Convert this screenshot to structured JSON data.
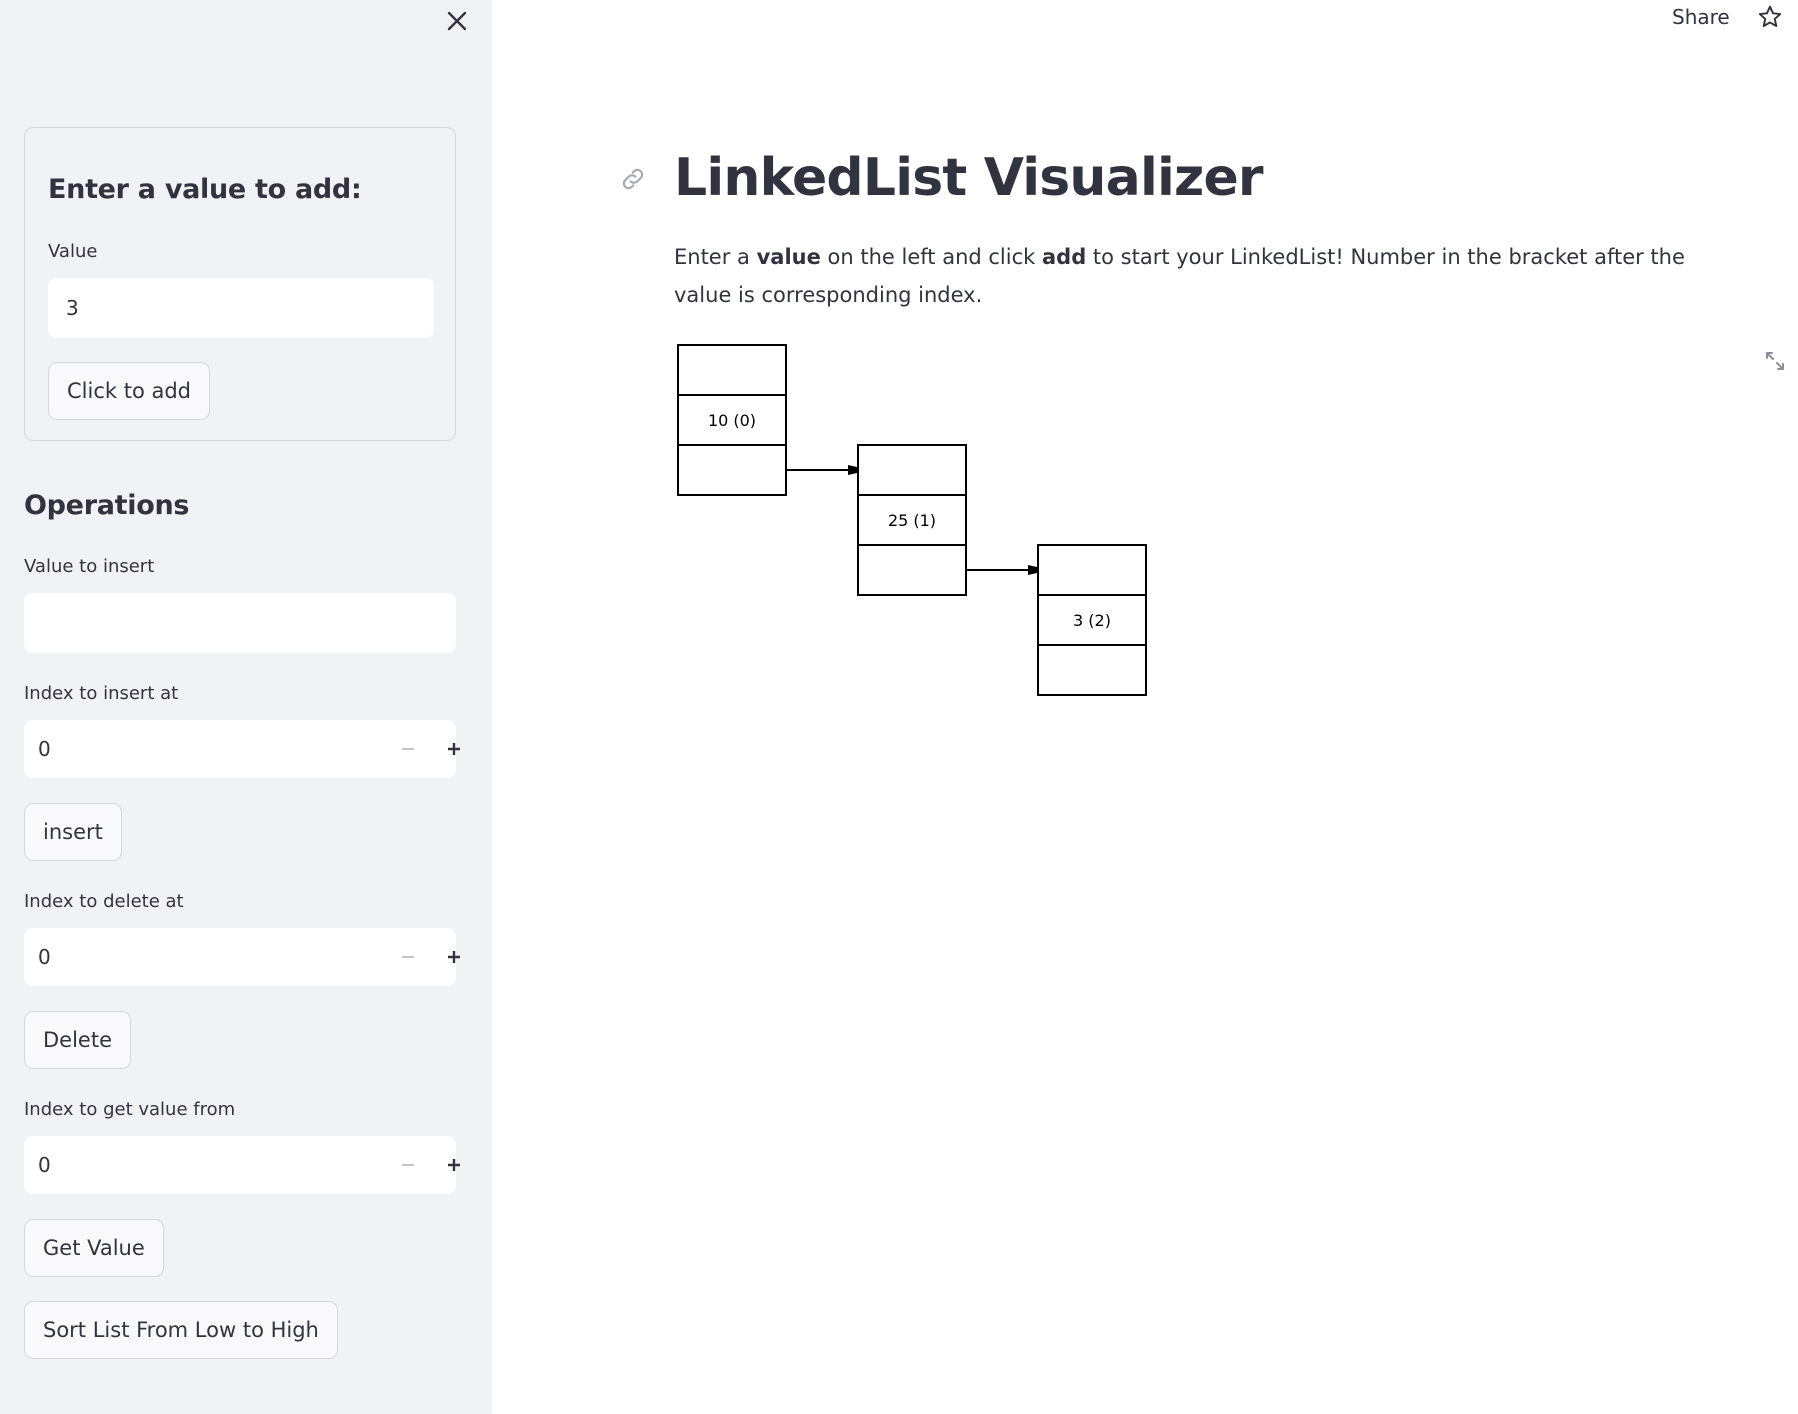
{
  "sidebar": {
    "add_form": {
      "heading": "Enter a value to add:",
      "value_label": "Value",
      "value": "3",
      "add_button": "Click to add"
    },
    "operations": {
      "heading": "Operations",
      "insert_value_label": "Value to insert",
      "insert_value": "",
      "insert_index_label": "Index to insert at",
      "insert_index": "0",
      "insert_button": "insert",
      "delete_index_label": "Index to delete at",
      "delete_index": "0",
      "delete_button": "Delete",
      "get_index_label": "Index to get value from",
      "get_index": "0",
      "get_button": "Get Value",
      "sort_button": "Sort List From Low to High"
    }
  },
  "header": {
    "share_label": "Share"
  },
  "main": {
    "title": "LinkedList Visualizer",
    "intro": {
      "part1": "Enter a ",
      "bold1": "value",
      "part2": " on the left and click ",
      "bold2": "add",
      "part3": " to start your LinkedList! Number in the bracket after the value is corresponding index."
    },
    "linked_list": {
      "nodes": [
        {
          "label": "10 (0)"
        },
        {
          "label": "25 (1)"
        },
        {
          "label": "3 (2)"
        }
      ]
    }
  },
  "icons": {
    "close": "close-icon",
    "star": "star-icon",
    "link": "link-icon",
    "expand": "expand-icon",
    "minus": "minus-icon",
    "plus": "plus-icon"
  }
}
